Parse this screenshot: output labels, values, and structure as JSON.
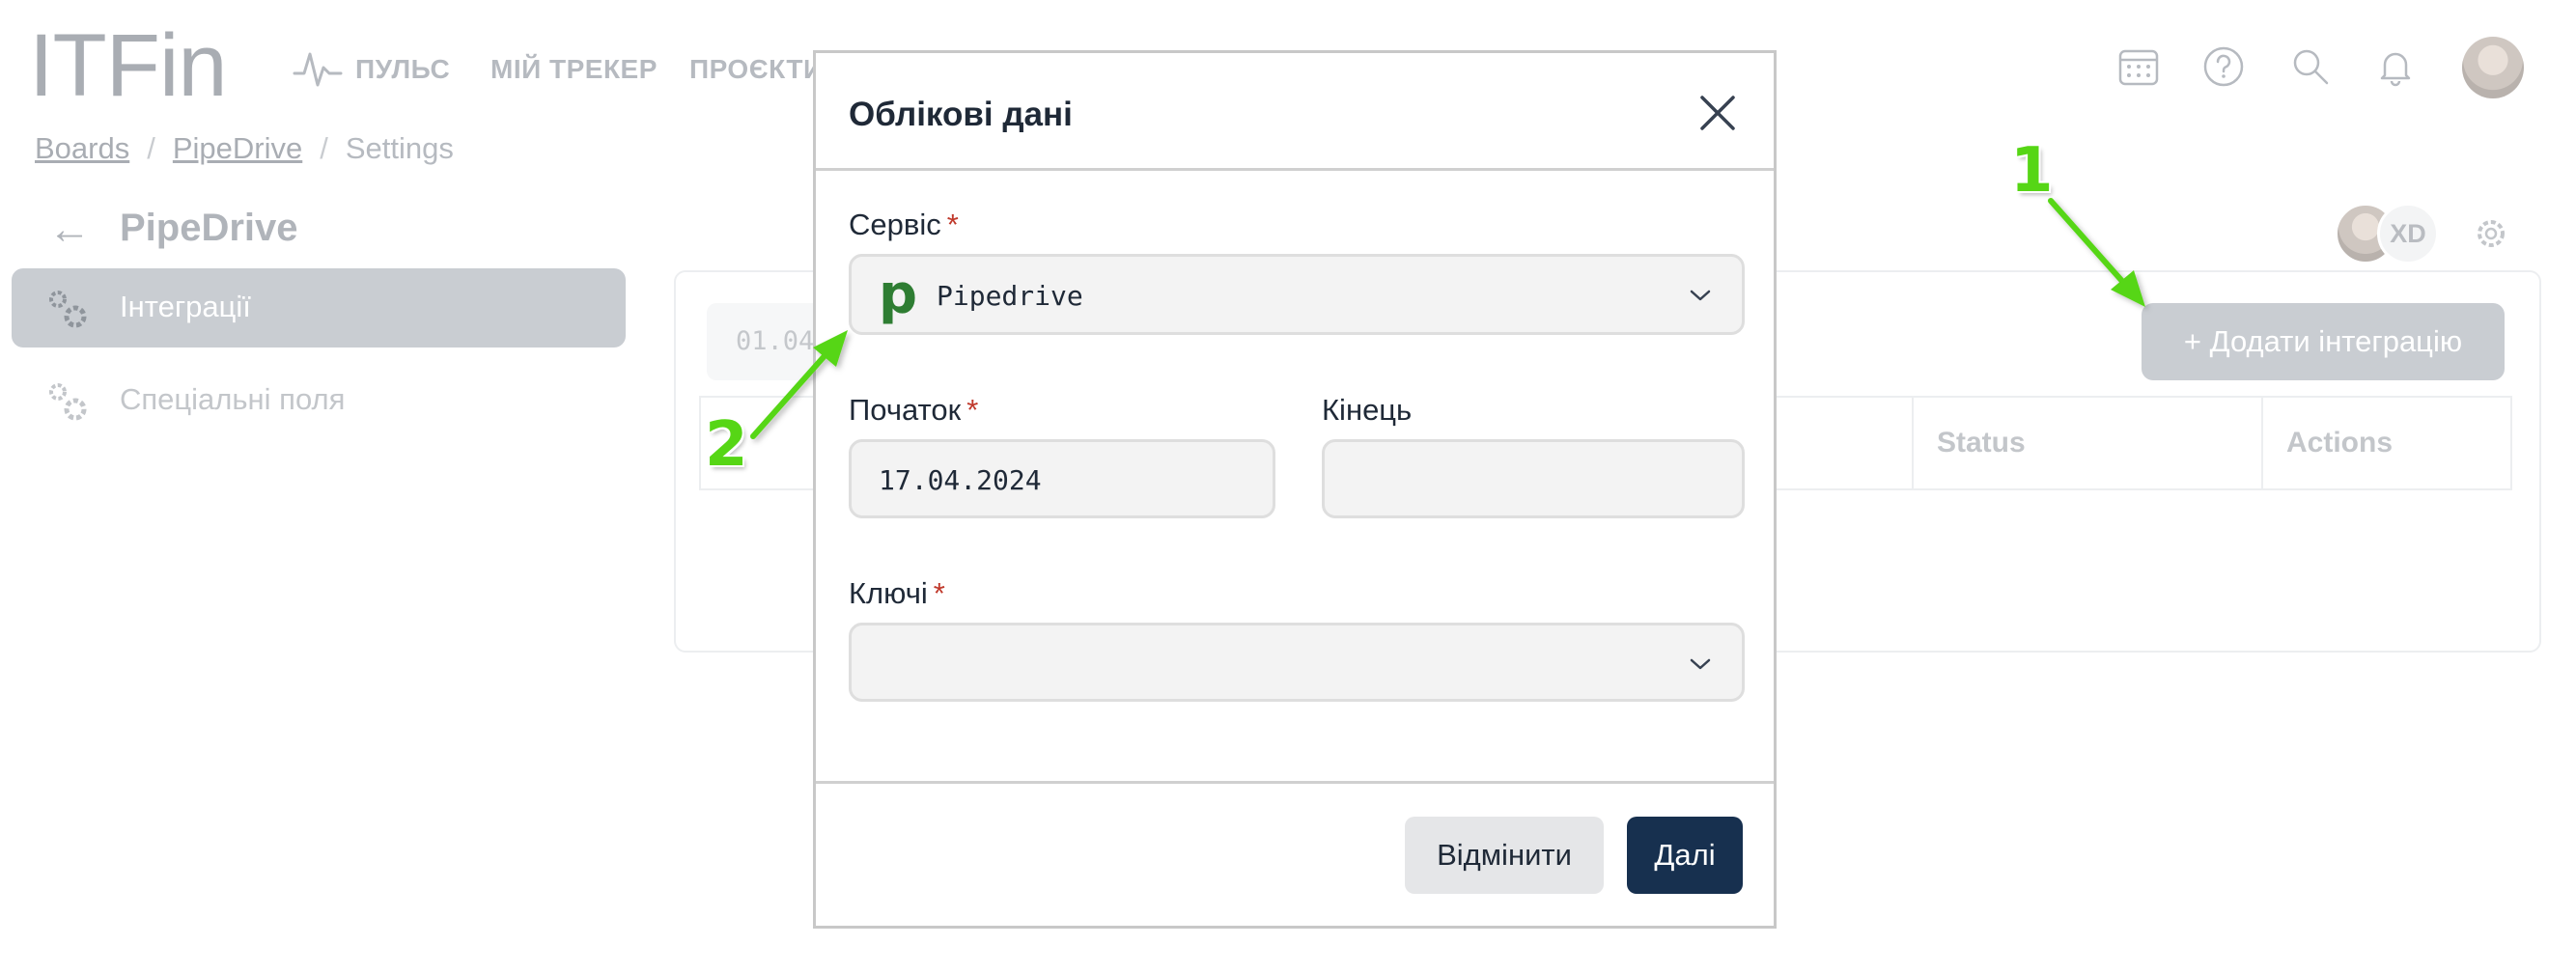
{
  "app": {
    "logo": "ITFin",
    "nav": [
      {
        "label": "ПУЛЬС",
        "icon": "pulse-icon"
      },
      {
        "label": "МІЙ ТРЕКЕР"
      },
      {
        "label": "ПРОЄКТИ"
      }
    ],
    "top_icons": [
      "calendar-icon",
      "help-icon",
      "search-icon",
      "bell-icon",
      "avatar"
    ]
  },
  "breadcrumb": {
    "items": [
      "Boards",
      "PipeDrive",
      "Settings"
    ],
    "separator": "/"
  },
  "page": {
    "back_icon": "arrow-left-icon",
    "title": "PipeDrive",
    "participants_initials": "XD"
  },
  "sidebar": {
    "items": [
      {
        "label": "Інтеграції",
        "icon": "gears-icon",
        "active": true
      },
      {
        "label": "Спеціальні поля",
        "icon": "gears-icon",
        "active": false
      }
    ]
  },
  "panel": {
    "date_filter": "01.04",
    "add_button": "+ Додати інтеграцію",
    "columns": [
      "Status",
      "Actions"
    ]
  },
  "modal": {
    "title": "Облікові дані",
    "service_label": "Сервіс",
    "service_value": "Pipedrive",
    "service_logo_letter": "p",
    "start_label": "Початок",
    "start_value": "17.04.2024",
    "end_label": "Кінець",
    "end_value": "",
    "keys_label": "Ключі",
    "keys_value": "",
    "required_mark": "*",
    "cancel_button": "Відмінити",
    "next_button": "Далі"
  },
  "annotations": [
    "1",
    "2"
  ],
  "colors": {
    "accent_dark": "#17304f",
    "annotation_green": "#56d615",
    "required_red": "#c0392b",
    "pipedrive_green": "#2e7d32"
  }
}
